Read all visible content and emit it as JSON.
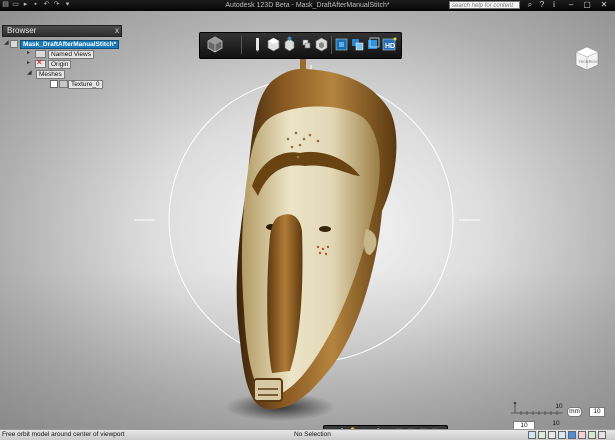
{
  "window": {
    "title": "Autodesk 123D Beta - Mask_DraftAfterManualStitch*",
    "search_placeholder": "search help for content"
  },
  "browser": {
    "header": "Browser",
    "root_label": "Mask_DraftAfterManualStitch*",
    "items": [
      {
        "label": "Named Views"
      },
      {
        "label": "Origin"
      },
      {
        "label": "Meshes"
      },
      {
        "label": "Texture_0"
      }
    ]
  },
  "zoom": {
    "top_value": "10",
    "left_value": "10",
    "unit_label": "mm",
    "bottom_value": "10",
    "scale_label": "10"
  },
  "status": {
    "left_text": "Free orbit model around center of viewport",
    "center_text": "No Selection"
  },
  "colors": {
    "selection": "#1a7ab8",
    "toolbar": "#1e1e1e",
    "mask_light": "#e6dcbf",
    "mask_dark": "#6a4312"
  },
  "icons": {
    "toolbar": [
      "cube-menu-icon",
      "pencil-icon",
      "primitive-box-icon",
      "move-icon",
      "group-icon",
      "combine-icon",
      "solid-icon",
      "material-icon",
      "hd-render-icon"
    ],
    "navbar": [
      "orbit-icon",
      "pan-icon",
      "zoom-icon",
      "look-icon",
      "fit-icon",
      "walk-icon",
      "steering-wheel-icon",
      "grid-icon",
      "layout-icon"
    ]
  }
}
